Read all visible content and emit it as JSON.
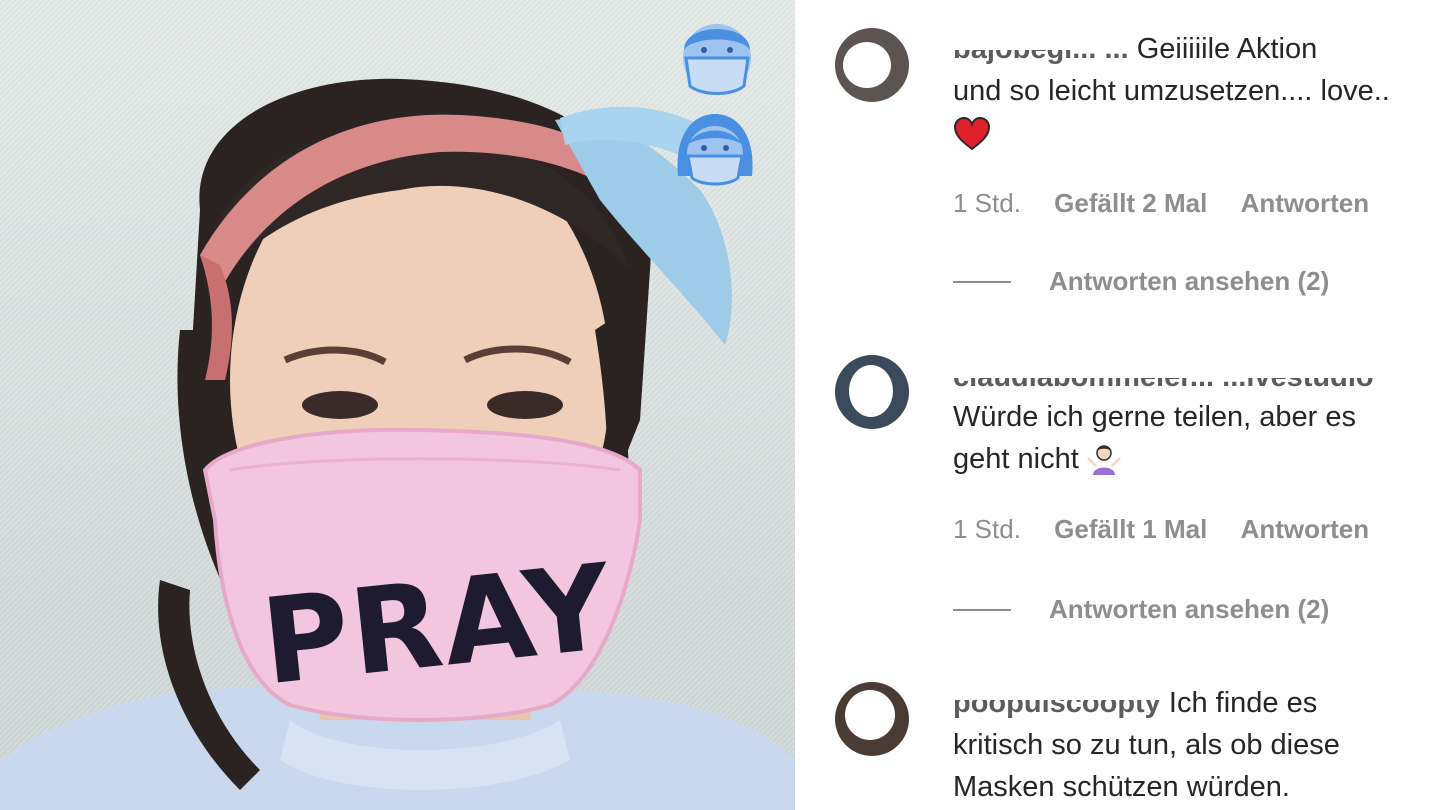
{
  "video": {
    "mask_print": "PRAY",
    "filter_icons": [
      "masked-man-icon",
      "masked-woman-icon"
    ],
    "colors": {
      "mask": "#f2c6de",
      "filter_icon": "#4a90e2"
    }
  },
  "comments": [
    {
      "username": "bajobegi... ...",
      "text_line1": "Geiiiiile Aktion",
      "text_line2": "und so leicht umzusetzen.... love..",
      "emoji": "red-heart",
      "time": "1 Std.",
      "likes": "Gefällt 2 Mal",
      "reply": "Antworten",
      "view_replies": "Antworten ansehen (2)"
    },
    {
      "username": "claudiabommeler... ...ivestudio",
      "text_line1": "Würde ich gerne teilen, aber es",
      "text_line2": "geht nicht",
      "emoji": "person-shrugging",
      "time": "1 Std.",
      "likes": "Gefällt 1 Mal",
      "reply": "Antworten",
      "view_replies": "Antworten ansehen (2)"
    },
    {
      "username": "poopulscoopty",
      "text_line1": "Ich finde es",
      "text_line2": "kritisch so zu tun, als ob diese",
      "text_line3": "Masken schützen würden."
    }
  ]
}
